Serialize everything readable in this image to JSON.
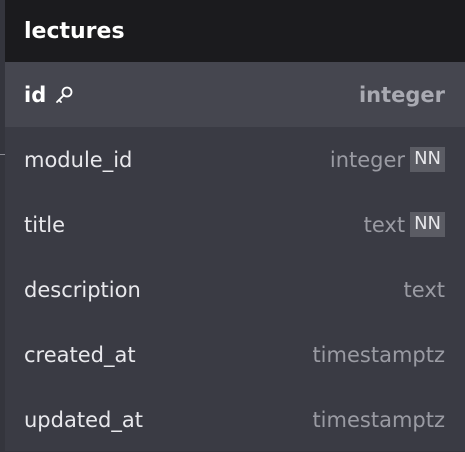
{
  "table": {
    "name": "lectures",
    "columns": [
      {
        "name": "id",
        "type": "integer",
        "primary_key": true,
        "badge": ""
      },
      {
        "name": "module_id",
        "type": "integer",
        "primary_key": false,
        "badge": "NN"
      },
      {
        "name": "title",
        "type": "text",
        "primary_key": false,
        "badge": "NN"
      },
      {
        "name": "description",
        "type": "text",
        "primary_key": false,
        "badge": ""
      },
      {
        "name": "created_at",
        "type": "timestamptz",
        "primary_key": false,
        "badge": ""
      },
      {
        "name": "updated_at",
        "type": "timestamptz",
        "primary_key": false,
        "badge": ""
      }
    ]
  },
  "icons": {
    "primary_key": "key-icon"
  },
  "colors": {
    "header_bg": "#1b1b1e",
    "body_bg": "#3a3b44",
    "pk_row_bg": "#45464f",
    "badge_bg": "#5b5c64"
  }
}
